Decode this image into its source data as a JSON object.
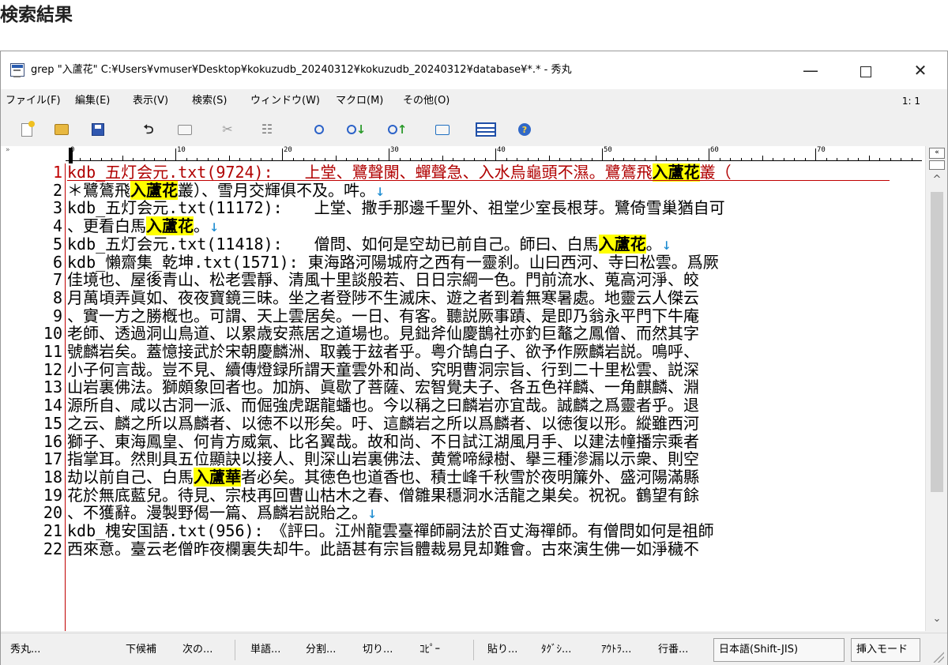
{
  "page_heading": "検索結果",
  "window": {
    "title": "grep \"入蘆花\" C:¥Users¥vmuser¥Desktop¥kokuzudb_20240312¥kokuzudb_20240312¥database¥*.* - 秀丸",
    "controls": {
      "minimize": "—",
      "close": "✕"
    }
  },
  "menubar": {
    "items": [
      "ファイル(F)",
      "編集(E)",
      "表示(V)",
      "検索(S)",
      "ウィンドウ(W)",
      "マクロ(M)",
      "その他(O)"
    ],
    "zoom": "1: 1"
  },
  "toolbar": {
    "icons": [
      "new-file-icon",
      "open-folder-icon",
      "save-icon",
      "undo-icon",
      "copy-icon",
      "cut-icon",
      "paste-icon",
      "search-icon",
      "find-next-icon",
      "find-prev-icon",
      "tag-jump-icon",
      "window-split-icon",
      "help-icon"
    ],
    "glyphs": {
      "undo": "⮌",
      "cut": "✂",
      "paste": "☷",
      "search": "🔍︎",
      "find_next": "↓",
      "find_prev": "↑",
      "help": "?"
    }
  },
  "ruler": {
    "labels": [
      "0",
      "10",
      "20",
      "30",
      "40",
      "50",
      "60",
      "70"
    ],
    "corner": "»"
  },
  "editor": {
    "current_line": 1,
    "eol_mark": "↓",
    "lines": [
      {
        "num": "1",
        "parts": [
          [
            "kdb_五灯会元.txt(9724):　　上堂、鷺聲闌、蟬聲急、入水烏龜頭不濕。鷺鷟飛",
            ""
          ],
          [
            "入蘆花",
            "hl"
          ],
          [
            "叢（",
            ""
          ]
        ]
      },
      {
        "num": "2",
        "parts": [
          [
            "＊鷺鷟飛",
            ""
          ],
          [
            "入蘆花",
            "hl"
          ],
          [
            "叢）、雪月交輝俱不及。吽。",
            ""
          ],
          [
            "↓",
            "eol"
          ]
        ]
      },
      {
        "num": "3",
        "parts": [
          [
            "kdb_五灯会元.txt(11172):　　上堂、撒手那邊千聖外、祖堂少室長根芽。鷺倚雪巢猶自可",
            ""
          ]
        ]
      },
      {
        "num": "4",
        "parts": [
          [
            "、更看白馬",
            ""
          ],
          [
            "入蘆花",
            "hl"
          ],
          [
            "。",
            ""
          ],
          [
            "↓",
            "eol"
          ]
        ]
      },
      {
        "num": "5",
        "parts": [
          [
            "kdb_五灯会元.txt(11418):　　僧問、如何是空劫已前自己。師曰、白馬",
            ""
          ],
          [
            "入蘆花",
            "hl"
          ],
          [
            "。",
            ""
          ],
          [
            "↓",
            "eol"
          ]
        ]
      },
      {
        "num": "6",
        "parts": [
          [
            "kdb_懶齋集_乾坤.txt(1571): 東海路河陽城府之西有一靈刹。山曰西河、寺曰松雲。爲厥",
            ""
          ]
        ]
      },
      {
        "num": "7",
        "parts": [
          [
            "佳境也、屋後青山、松老雲靜、清風十里談般若、日日宗綱一色。門前流水、蒐高河淨、皎",
            ""
          ]
        ]
      },
      {
        "num": "8",
        "parts": [
          [
            "月萬頃弄眞如、夜夜寶鏡三昧。坐之者登陟不生滅床、遊之者到着無寒暑處。地靈云人傑云",
            ""
          ]
        ]
      },
      {
        "num": "9",
        "parts": [
          [
            "、實一方之勝槪也。可謂、天上雲居矣。一日、有客。聽説厥事蹟、是即乃翁永平門下牛庵",
            ""
          ]
        ]
      },
      {
        "num": "10",
        "parts": [
          [
            "老師、透過洞山鳥道、以累歳安燕居之道場也。見鈯斧仙慶鵲社亦釣巨鼇之鳳僧、而然其字",
            ""
          ]
        ]
      },
      {
        "num": "11",
        "parts": [
          [
            "號麟岩矣。蓋憶接武於宋朝慶麟洲、取義于玆者乎。粤介鵠白子、欲予作厥麟岩説。鳴呼、",
            ""
          ]
        ]
      },
      {
        "num": "12",
        "parts": [
          [
            "小子何言哉。豈不見、續傳燈録所謂天童雲外和尚、究明曹洞宗旨、行到二十里松雲、説深",
            ""
          ]
        ]
      },
      {
        "num": "13",
        "parts": [
          [
            "山岩裏佛法。獅頗象回者也。加旃、眞歇了菩薩、宏智覺夫子、各五色祥麟、一角麒麟、淵",
            ""
          ]
        ]
      },
      {
        "num": "14",
        "parts": [
          [
            "源所自、咸以古洞一派、而倔強虎踞龍蟠也。今以稱之曰麟岩亦宜哉。誠麟之爲靈者乎。退",
            ""
          ]
        ]
      },
      {
        "num": "15",
        "parts": [
          [
            "之云、麟之所以爲麟者、以徳不以形矣。吁、這麟岩之所以爲麟者、以徳復以形。縱雖西河",
            ""
          ]
        ]
      },
      {
        "num": "16",
        "parts": [
          [
            "獅子、東海鳳皇、何肯方威氣、比名翼哉。故和尚、不日試江湖風月手、以建法幢播宗乘者",
            ""
          ]
        ]
      },
      {
        "num": "17",
        "parts": [
          [
            "指掌耳。然則具五位顯訣以接人、則深山岩裏佛法、黄鶯啼緑樹、擧三種滲漏以示衆、則空",
            ""
          ]
        ]
      },
      {
        "num": "18",
        "parts": [
          [
            "劫以前自己、白馬",
            ""
          ],
          [
            "入蘆華",
            "hl"
          ],
          [
            "者必矣。其徳色也道香也、積士峰千秋雪於夜明簾外、盛河陽滿縣",
            ""
          ]
        ]
      },
      {
        "num": "19",
        "parts": [
          [
            "花於無底藍兒。待見、宗枝再回曹山枯木之春、僧雛果穩洞水活龍之巣矣。祝祝。鶴望有餘",
            ""
          ]
        ]
      },
      {
        "num": "20",
        "parts": [
          [
            "、不獲辭。漫製野偈一篇、爲麟岩説貽之。",
            ""
          ],
          [
            "↓",
            "eol"
          ]
        ]
      },
      {
        "num": "21",
        "parts": [
          [
            "kdb_槐安国語.txt(956):　《評曰。江州龍雲臺禪師嗣法於百丈海禪師。有僧問如何是祖師",
            ""
          ]
        ]
      },
      {
        "num": "22",
        "parts": [
          [
            "西來意。臺云老僧昨夜欄裏失却牛。此語甚有宗旨體裁易見却難會。古來演生佛一如淨穢不",
            ""
          ]
        ]
      }
    ]
  },
  "scrollbar": {
    "up": "^",
    "down": "⌄",
    "top_button": "«"
  },
  "statusbar": {
    "app": "秀丸...",
    "items": [
      "下候補",
      "次の...",
      "単語...",
      "分割...",
      "切り...",
      "ｺﾋﾟｰ",
      "貼り...",
      "ﾀｸﾞｼ...",
      "ｱｳﾄﾗ...",
      "行番..."
    ],
    "encoding": "日本語(Shift-JIS)",
    "mode": "挿入モード"
  }
}
